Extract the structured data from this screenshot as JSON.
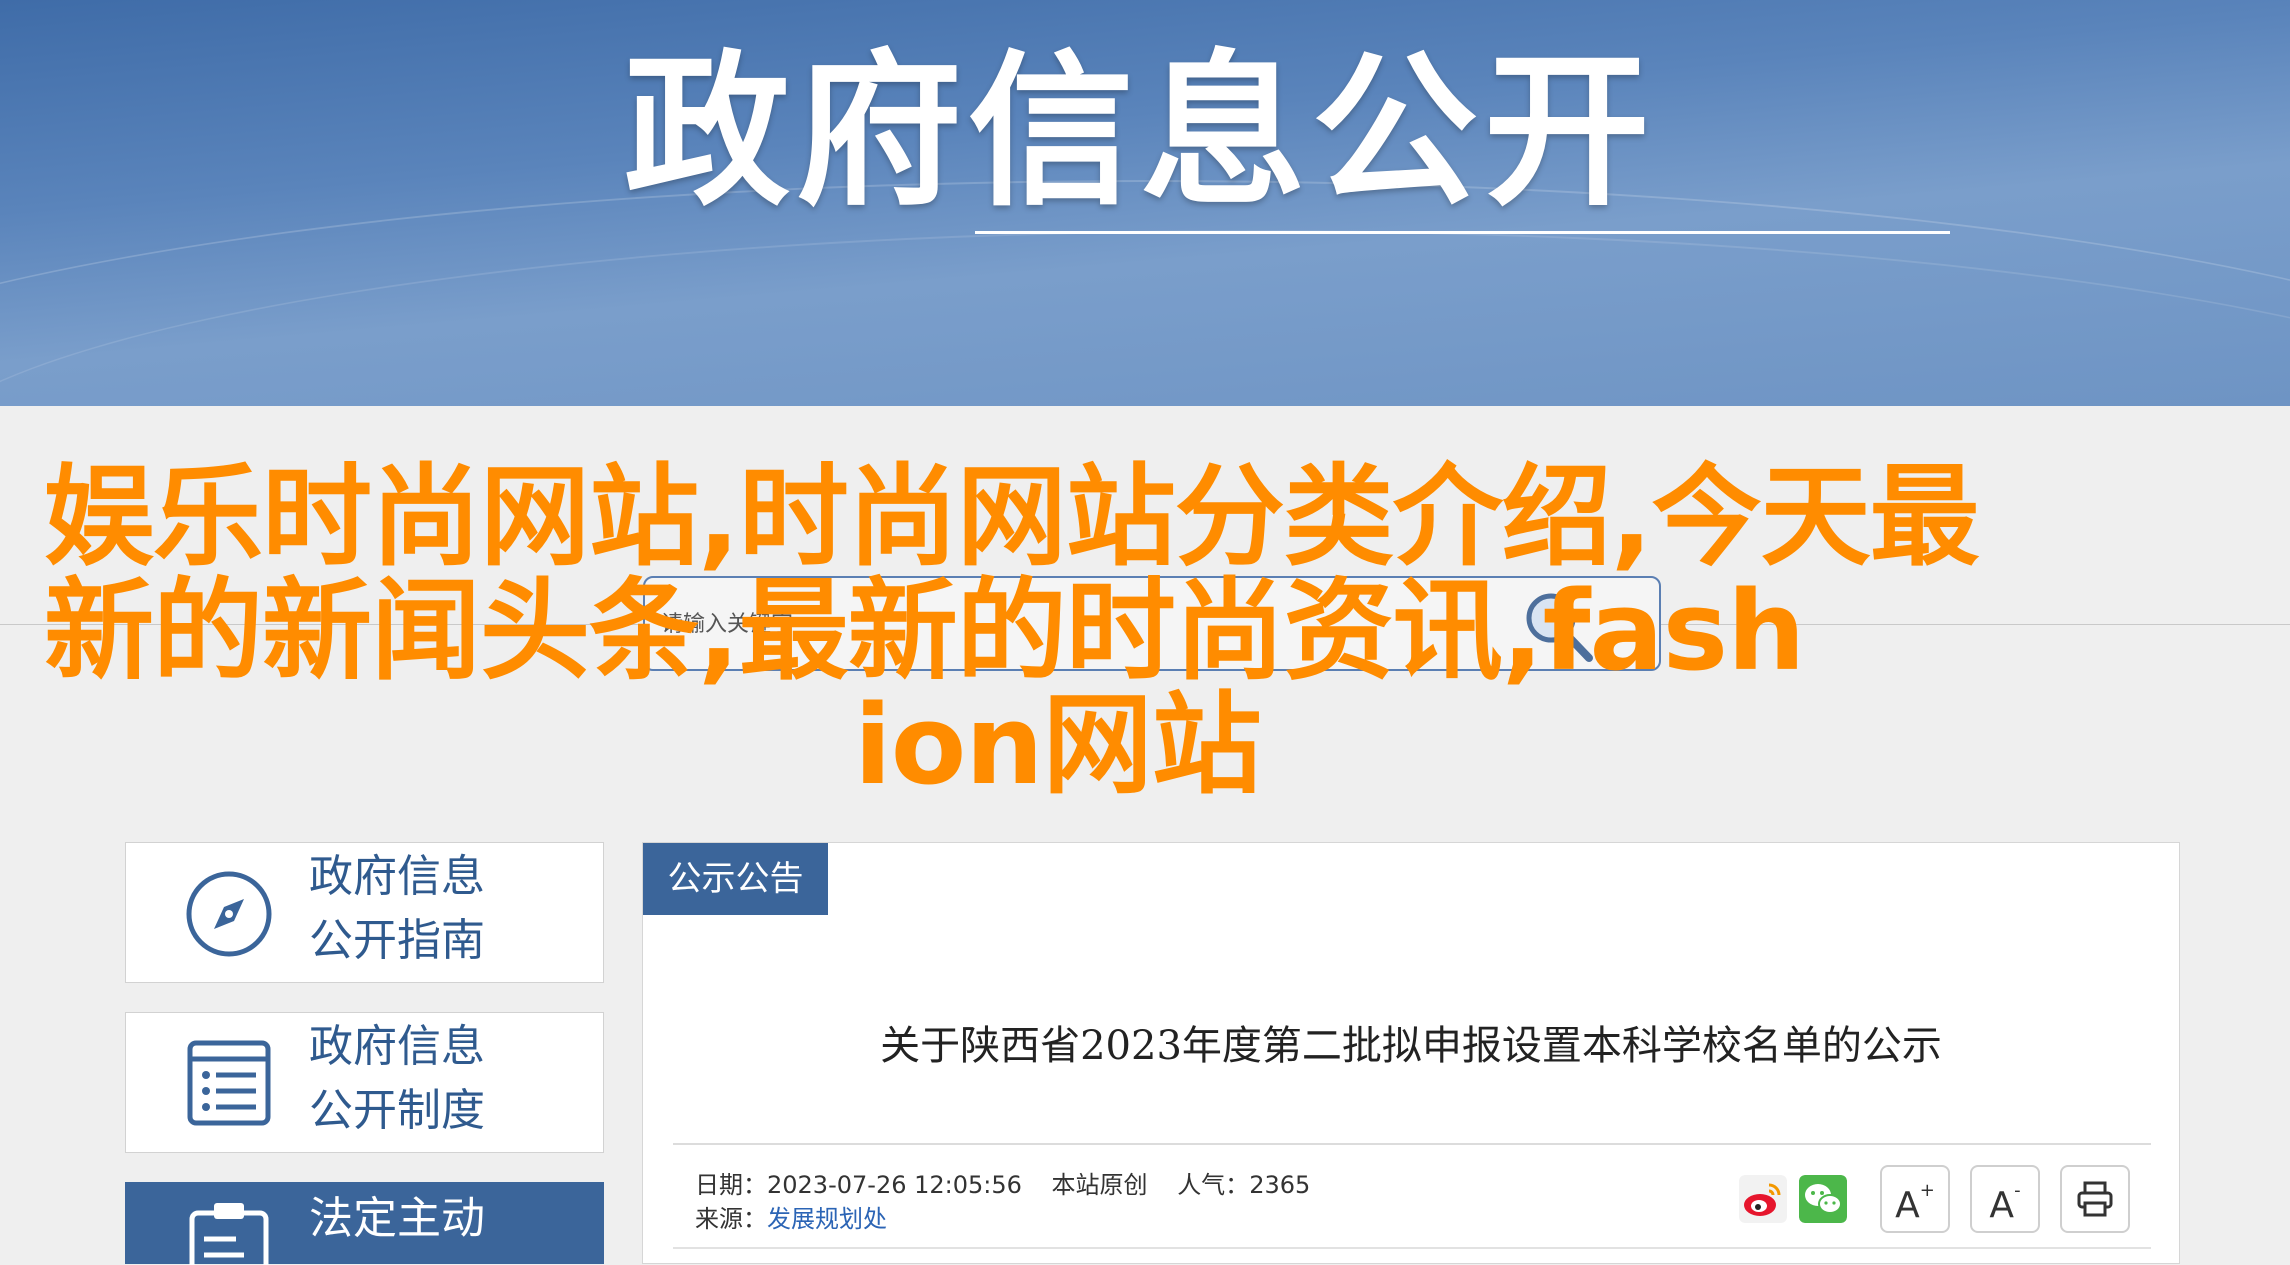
{
  "banner": {
    "title": "政府信息公开"
  },
  "search": {
    "placeholder": "请输入关键字"
  },
  "headline": {
    "line1": "娱乐时尚网站,时尚网站分类介绍,今天最",
    "line2": "新的新闻头条,最新的时尚资讯,fash",
    "line3": "ion网站"
  },
  "sidebar": {
    "items": [
      {
        "line1": "政府信息",
        "line2": "公开指南",
        "icon": "compass-icon"
      },
      {
        "line1": "政府信息",
        "line2": "公开制度",
        "icon": "document-list-icon"
      },
      {
        "line1": "法定主动",
        "line2": "",
        "icon": "clipboard-icon"
      }
    ]
  },
  "main": {
    "tab_label": "公示公告",
    "article_title": "关于陕西省2023年度第二批拟申报设置本科学校名单的公示",
    "meta": {
      "date_label": "日期：",
      "date_value": "2023-07-26 12:05:56",
      "origin": "本站原创",
      "views_label": "人气：",
      "views_value": "2365",
      "source_label": "来源：",
      "source_value": "发展规划处"
    },
    "tools": {
      "font_increase": "A",
      "font_increase_sup": "+",
      "font_decrease": "A",
      "font_decrease_sup": "-"
    }
  },
  "colors": {
    "brand_blue": "#3b659a",
    "headline_orange": "#ff8c00",
    "link_blue": "#2b64b5"
  }
}
